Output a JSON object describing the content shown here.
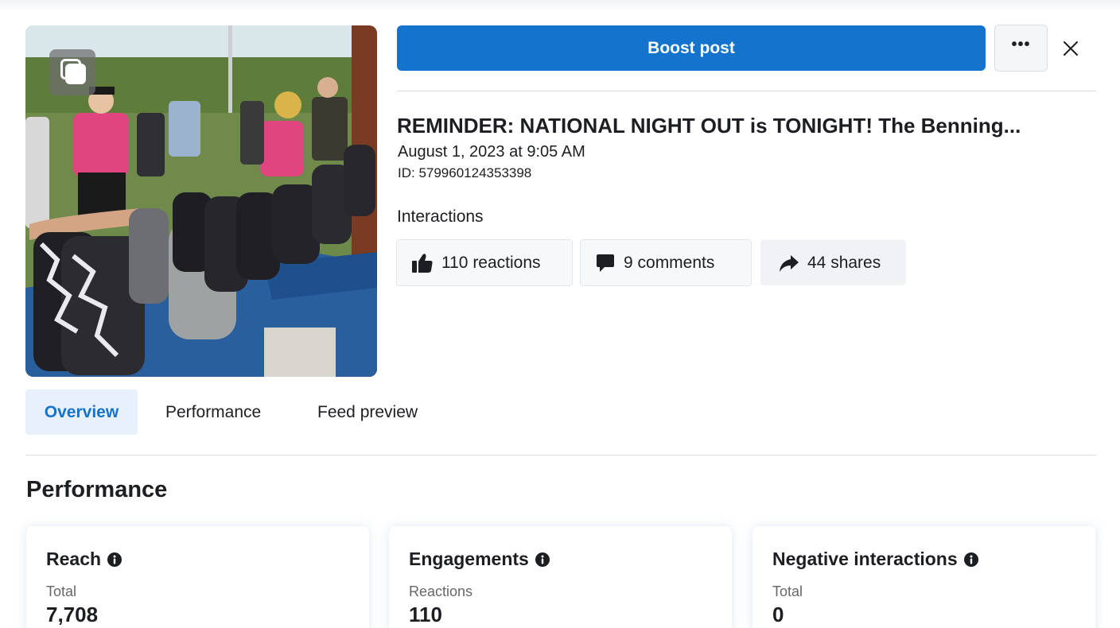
{
  "header": {
    "boost_label": "Boost post",
    "more_label": "•••",
    "close_icon": "close-icon"
  },
  "post": {
    "title": "REMINDER: NATIONAL NIGHT OUT is TONIGHT! The Benning...",
    "date": "August 1, 2023 at 9:05 AM",
    "id_text": "ID: 579960124353398",
    "media_icon": "multiple-photos-icon"
  },
  "interactions": {
    "label": "Interactions",
    "reactions": "110 reactions",
    "comments": "9 comments",
    "shares": "44 shares"
  },
  "tabs": [
    {
      "label": "Overview",
      "active": true
    },
    {
      "label": "Performance",
      "active": false
    },
    {
      "label": "Feed preview",
      "active": false
    }
  ],
  "performance": {
    "title": "Performance",
    "cards": [
      {
        "title": "Reach",
        "sub": "Total",
        "value": "7,708"
      },
      {
        "title": "Engagements",
        "sub": "Reactions",
        "value": "110"
      },
      {
        "title": "Negative interactions",
        "sub": "Total",
        "value": "0"
      }
    ]
  },
  "colors": {
    "accent": "#1473cc",
    "tab_active_bg": "#e7f0fb",
    "text": "#1c1e21",
    "secondary_text": "#65676b"
  }
}
